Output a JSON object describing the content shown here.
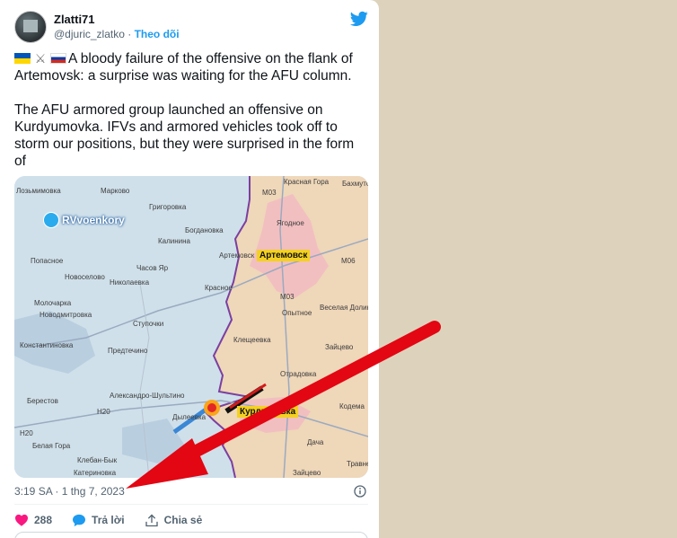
{
  "tweet": {
    "author_name": "Zlatti71",
    "handle": "@djuric_zlatko",
    "separator": "·",
    "follow_label": "Theo dõi",
    "text_line1": "A bloody failure of the offensive on the flank of Artemovsk: a surprise was waiting for the AFU column.",
    "text_para2": "The AFU armored group launched an offensive on Kurdyumovka. IFVs and armored vehicles took off to storm our positions, but they were surprised in the form of",
    "timestamp": "3:19 SA · 1 thg 7, 2023",
    "like_count": "288",
    "reply_label": "Trả lời",
    "share_label": "Chia sẻ"
  },
  "map": {
    "watermark": "RVvoenkory",
    "city_main": "Артемовск",
    "city_target": "Курдюмовка",
    "labels": {
      "l1": "Лозьмимовка",
      "l2": "Марково",
      "l3": "Григоровка",
      "l4": "Красная Гора",
      "l5": "Бахмутс",
      "l6": "Богдановка",
      "l7": "Калинина",
      "l8": "Ягодное",
      "l9": "Попасное",
      "l10": "Часов Яр",
      "l11": "Артемовск",
      "l12": "Новоселово",
      "l13": "Николаевка",
      "l14": "Красное",
      "l15": "Молочарка",
      "l16": "Новодмитровка",
      "l17": "Ступочки",
      "l18": "Опытное",
      "l19": "Веселая Долина",
      "l20": "Константиновка",
      "l21": "Предтечино",
      "l22": "Клещеевка",
      "l23": "Зайцево",
      "l24": "Отрадовка",
      "l25": "Берестов",
      "l26": "Александро-Шультино",
      "l27": "Дылеевка",
      "l28": "Кодема",
      "l29": "Дача",
      "l30": "Катериновка",
      "l31": "Зайцево",
      "l32": "Травне",
      "l33": "Белая Гора",
      "l34": "Клебан-Бык"
    },
    "road_labels": {
      "r1": "M03",
      "r2": "M03",
      "r3": "M06",
      "r4": "H20",
      "r5": "H20"
    }
  },
  "colors": {
    "brand": "#1d9bf0",
    "like": "#f91880",
    "arrow_red": "#e30613",
    "front_purple": "#7b3fa0",
    "occupied": "#efd7b9",
    "held": "#d7e6ee"
  }
}
